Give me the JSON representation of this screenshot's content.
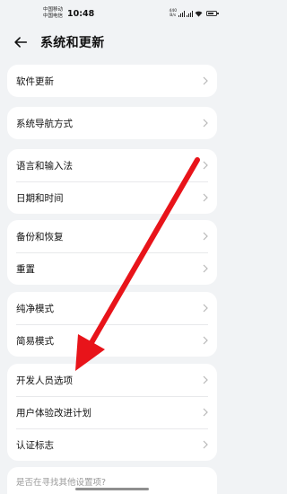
{
  "status_bar": {
    "carrier_1": "中国移动",
    "carrier_2": "中国电信",
    "time": "10:48",
    "network_speed_top": "440",
    "network_speed_unit": "B/s"
  },
  "header": {
    "title": "系统和更新",
    "back_icon": "arrow-left-icon"
  },
  "groups": [
    {
      "items": [
        {
          "label": "软件更新"
        }
      ]
    },
    {
      "items": [
        {
          "label": "系统导航方式"
        }
      ]
    },
    {
      "items": [
        {
          "label": "语言和输入法"
        },
        {
          "label": "日期和时间"
        }
      ]
    },
    {
      "items": [
        {
          "label": "备份和恢复"
        },
        {
          "label": "重置"
        }
      ]
    },
    {
      "items": [
        {
          "label": "纯净模式"
        },
        {
          "label": "简易模式"
        }
      ]
    },
    {
      "items": [
        {
          "label": "开发人员选项"
        },
        {
          "label": "用户体验改进计划"
        },
        {
          "label": "认证标志"
        }
      ]
    }
  ],
  "partial_footer": {
    "label": "是否在寻找其他设置项?"
  },
  "annotation": {
    "arrow_color": "#e8141a",
    "target": "开发人员选项"
  },
  "colors": {
    "background": "#f1f3f5",
    "card": "#ffffff",
    "chevron": "#b8b8b8"
  }
}
